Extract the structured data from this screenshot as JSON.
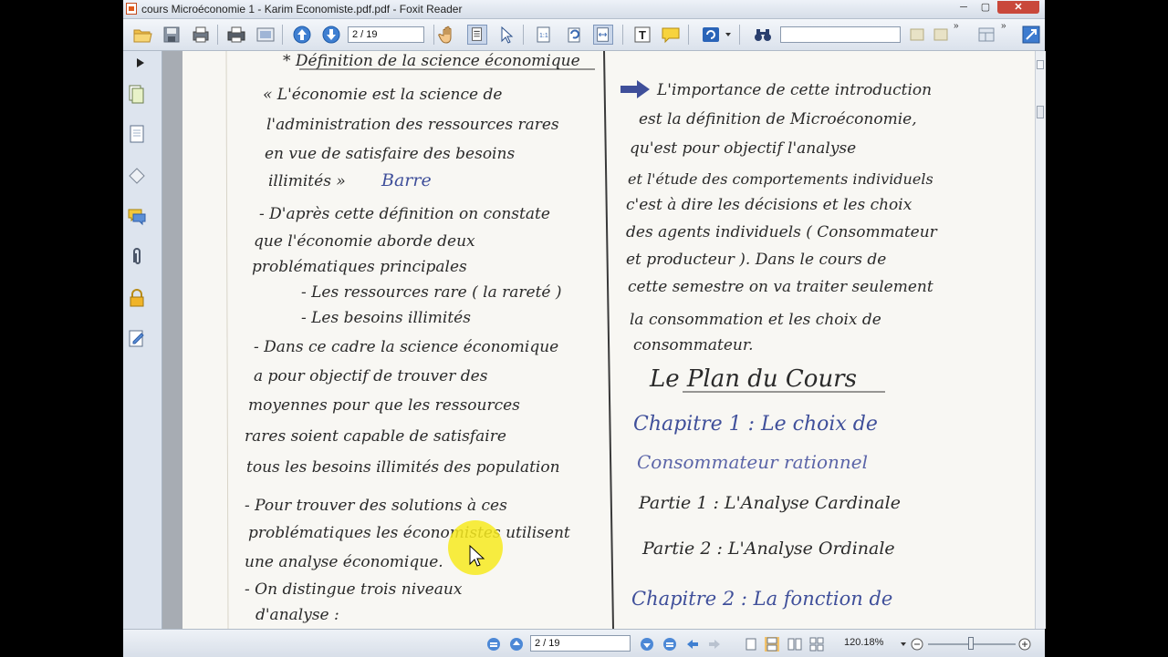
{
  "window": {
    "title": "cours Microéconomie 1 - Karim Economiste.pdf.pdf - Foxit Reader",
    "min": "─",
    "max": "▢",
    "close": "✕"
  },
  "toolbar": {
    "page_field": "2 / 19",
    "search_value": ""
  },
  "status": {
    "page_field": "2 / 19",
    "zoom": "120.18%"
  },
  "document": {
    "left_column": [
      "* Définition de la science économique",
      "« L'économie est la science de",
      "l'administration des ressources rares",
      "en vue de satisfaire des besoins",
      "illimités »",
      "Barre",
      "- D'après cette définition on constate",
      "que l'économie aborde deux",
      "problématiques principales",
      "- Les ressources rare ( la rareté )",
      "- Les besoins illimités",
      "- Dans ce cadre la science économique",
      "a pour objectif de trouver des",
      "moyennes pour que les ressources",
      "rares soient capable de satisfaire",
      "tous les besoins illimités des population",
      "- Pour trouver des solutions à ces",
      "problématiques les économistes utilisent",
      "une analyse économique.",
      "- On distingue trois niveaux",
      "d'analyse :"
    ],
    "right_column": [
      "L'importance de cette introduction",
      "est la définition de Microéconomie,",
      "qu'est pour objectif l'analyse",
      "et l'étude des comportements individuels",
      "c'est à dire les décisions et les choix",
      "des agents individuels ( Consommateur",
      "et producteur ). Dans le cours de",
      "cette semestre on va traiter seulement",
      "la consommation et les choix de",
      "consommateur.",
      "Le Plan du Cours",
      "Chapitre 1 : Le choix de",
      "Consommateur rationnel",
      "Partie 1 : L'Analyse Cardinale",
      "Partie 2 : L'Analyse Ordinale",
      "Chapitre 2 : La fonction de"
    ]
  }
}
